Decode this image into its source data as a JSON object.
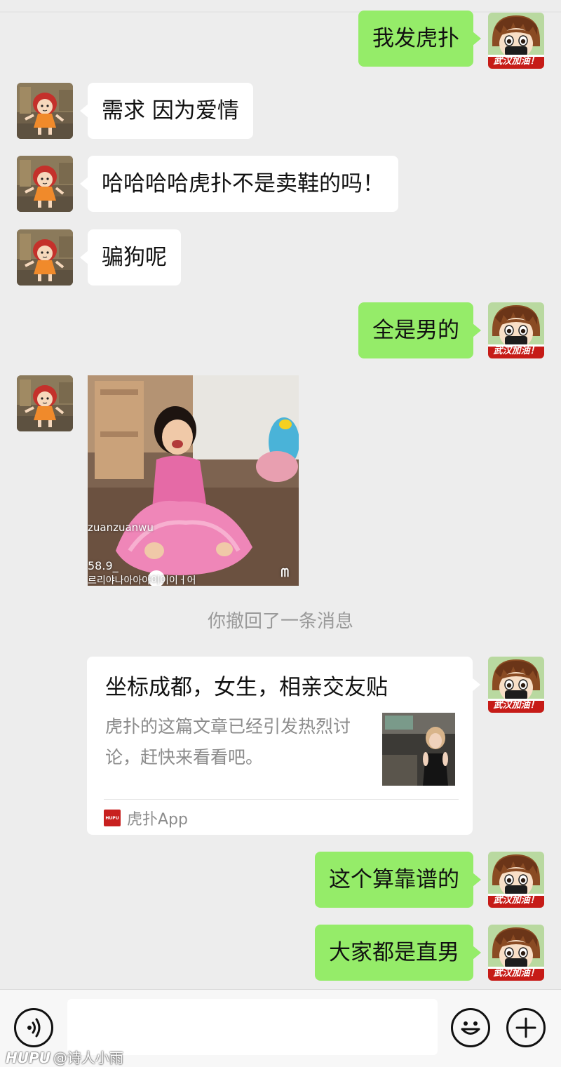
{
  "messages": [
    {
      "from": "me",
      "text": "我发虎扑"
    },
    {
      "from": "them",
      "text": "需求 因为爱情"
    },
    {
      "from": "them",
      "text": "哈哈哈哈虎扑不是卖鞋的吗！"
    },
    {
      "from": "them",
      "text": "骗狗呢"
    },
    {
      "from": "me",
      "text": "全是男的"
    },
    {
      "from": "me",
      "text": "这个算靠谱的"
    },
    {
      "from": "me",
      "text": "大家都是直男"
    }
  ],
  "avatars": {
    "me_badge": "武汉加油！"
  },
  "photo": {
    "username": "zuanzuanwu",
    "count": "58.9_",
    "caption": "르리야나아아아이이이ㅓ어",
    "mark": "ᗰ"
  },
  "system_note": "你撤回了一条消息",
  "card": {
    "title": "坐标成都，女生，相亲交友贴",
    "description": "虎扑的这篇文章已经引发热烈讨论，赶快来看看吧。",
    "logo_text": "HUPU",
    "source": "虎扑App"
  },
  "input_bar": {
    "voice_icon": "voice-icon",
    "emoji_icon": "emoji-icon",
    "plus_icon": "plus-icon"
  },
  "watermark": {
    "brand": "HUPU",
    "author": "@诗人小雨"
  },
  "colors": {
    "background": "#ededed",
    "outgoing_bubble": "#95ec69",
    "incoming_bubble": "#ffffff",
    "hupu_red": "#c8201f"
  }
}
